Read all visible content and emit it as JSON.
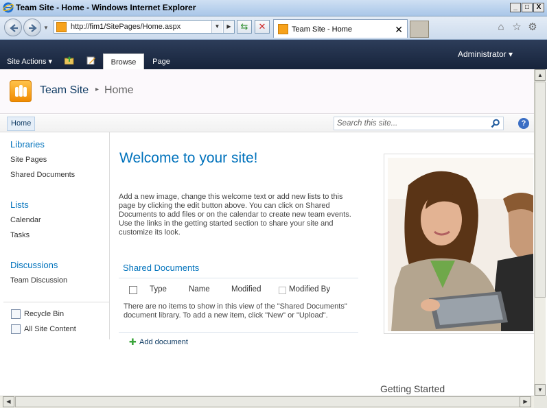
{
  "window": {
    "title": "Team Site - Home - Windows Internet Explorer",
    "minimize_glyph": "_",
    "maximize_glyph": "□",
    "close_glyph": "X"
  },
  "address_bar": {
    "url_prefix": "http://",
    "url_host": "fim1",
    "url_path": "/SitePages/Home.aspx",
    "tab_label": "Team Site - Home",
    "tab_close": "✕"
  },
  "ribbon": {
    "site_actions": "Site Actions ▾",
    "tabs": [
      "Browse",
      "Page"
    ],
    "user": "Administrator ▾"
  },
  "header": {
    "site_title": "Team Site",
    "breadcrumb_separator": "▸",
    "breadcrumb_current": "Home"
  },
  "top_nav": {
    "home": "Home",
    "search_placeholder": "Search this site...",
    "help": "?"
  },
  "left_nav": {
    "sections": [
      {
        "heading": "Libraries",
        "items": [
          "Site Pages",
          "Shared Documents"
        ]
      },
      {
        "heading": "Lists",
        "items": [
          "Calendar",
          "Tasks"
        ]
      },
      {
        "heading": "Discussions",
        "items": [
          "Team Discussion"
        ]
      }
    ],
    "recycle_bin": "Recycle Bin",
    "all_site_content": "All Site Content"
  },
  "main": {
    "welcome_title": "Welcome to your site!",
    "intro_text": "Add a new image, change this welcome text or add new lists to this page by clicking the edit button above. You can click on Shared Documents to add files or on the calendar to create new team events. Use the links in the getting started section to share your site and customize its look.",
    "shared_docs": {
      "title": "Shared Documents",
      "columns": [
        "Type",
        "Name",
        "Modified",
        "Modified By"
      ],
      "empty_message": "There are no items to show in this view of the \"Shared Documents\" document library. To add a new item, click \"New\" or \"Upload\".",
      "add_document": "Add document"
    },
    "getting_started": "Getting Started"
  },
  "colors": {
    "accent": "#0072bc",
    "ribbon_bg": "#1b2a43",
    "logo_orange": "#f7a21b"
  }
}
